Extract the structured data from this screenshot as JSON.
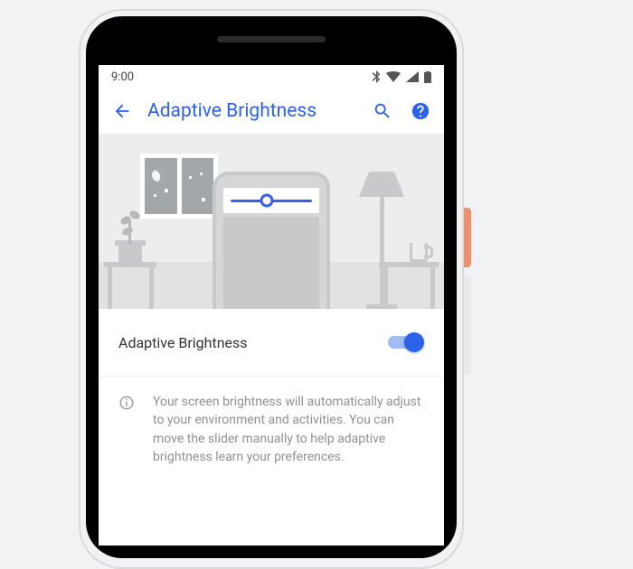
{
  "statusbar": {
    "time": "9:00"
  },
  "appbar": {
    "title": "Adaptive Brightness"
  },
  "toggle": {
    "label": "Adaptive Brightness",
    "on": true
  },
  "info": {
    "text": "Your screen brightness will automatically adjust to your environment and activities. You can move the slider manually to help adaptive brightness learn your preferences."
  },
  "colors": {
    "accent": "#2a62ea"
  }
}
